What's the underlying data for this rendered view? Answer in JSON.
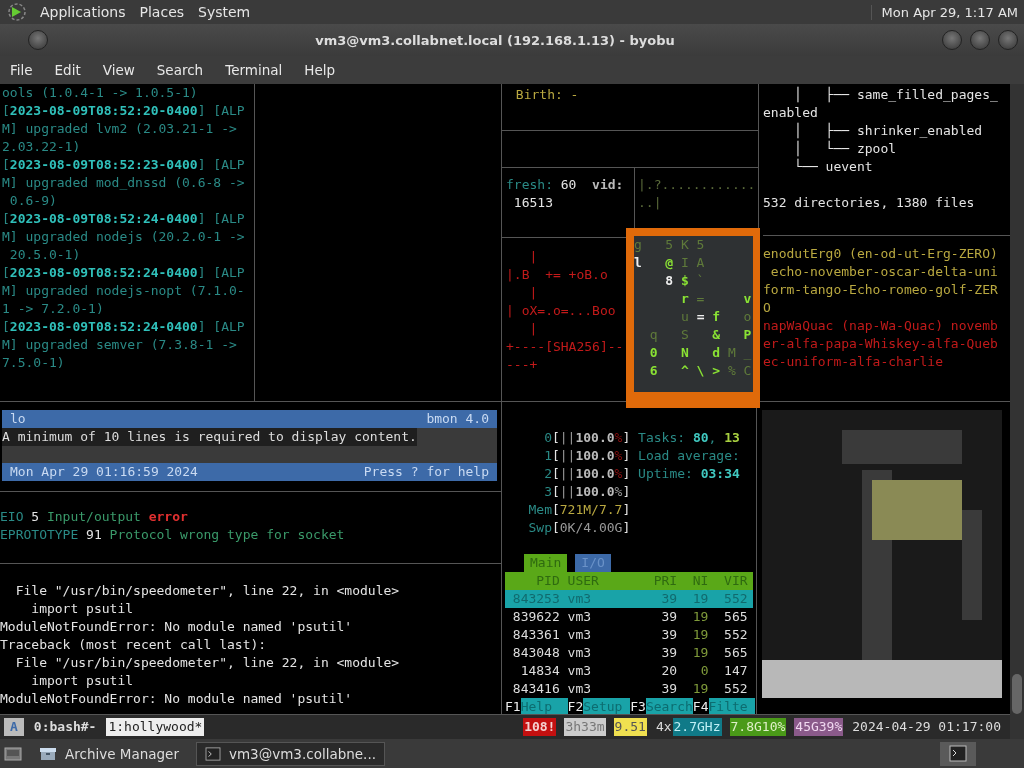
{
  "top_panel": {
    "menus": [
      "Applications",
      "Places",
      "System"
    ],
    "clock": "Mon Apr 29, 1:17 AM"
  },
  "window": {
    "title": "vm3@vm3.collabnet.local (192.168.1.13) - byobu",
    "menu": [
      "File",
      "Edit",
      "View",
      "Search",
      "Terminal",
      "Help"
    ]
  },
  "log": [
    [
      {
        "text": "ools (1.0.4-1 -> 1.0.5-1)",
        "kind": "dim"
      }
    ],
    [
      {
        "text": "[",
        "kind": "dim"
      },
      {
        "text": "2023-08-09T08:52:20-0400",
        "kind": "ts"
      },
      {
        "text": "] [ALP",
        "kind": "dim"
      }
    ],
    [
      {
        "text": "M] upgraded lvm2 (2.03.21-1 ->",
        "kind": "dim"
      }
    ],
    [
      {
        "text": "2.03.22-1)",
        "kind": "dim"
      }
    ],
    [
      {
        "text": "[",
        "kind": "dim"
      },
      {
        "text": "2023-08-09T08:52:23-0400",
        "kind": "ts"
      },
      {
        "text": "] [ALP",
        "kind": "dim"
      }
    ],
    [
      {
        "text": "M] upgraded mod_dnssd (0.6-8 ->",
        "kind": "dim"
      }
    ],
    [
      {
        "text": " 0.6-9)",
        "kind": "dim"
      }
    ],
    [
      {
        "text": "[",
        "kind": "dim"
      },
      {
        "text": "2023-08-09T08:52:24-0400",
        "kind": "ts"
      },
      {
        "text": "] [ALP",
        "kind": "dim"
      }
    ],
    [
      {
        "text": "M] upgraded nodejs (20.2.0-1 ->",
        "kind": "dim"
      }
    ],
    [
      {
        "text": " 20.5.0-1)",
        "kind": "dim"
      }
    ],
    [
      {
        "text": "[",
        "kind": "dim"
      },
      {
        "text": "2023-08-09T08:52:24-0400",
        "kind": "ts"
      },
      {
        "text": "] [ALP",
        "kind": "dim"
      }
    ],
    [
      {
        "text": "M] upgraded nodejs-nopt (7.1.0-",
        "kind": "dim"
      }
    ],
    [
      {
        "text": "1 -> 7.2.0-1)",
        "kind": "dim"
      }
    ],
    [
      {
        "text": "[",
        "kind": "dim"
      },
      {
        "text": "2023-08-09T08:52:24-0400",
        "kind": "ts"
      },
      {
        "text": "] [ALP",
        "kind": "dim"
      }
    ],
    [
      {
        "text": "M] upgraded semver (7.3.8-1 ->",
        "kind": "dim"
      }
    ],
    [
      {
        "text": "7.5.0-1)",
        "kind": "dim"
      }
    ]
  ],
  "stat": {
    "birth": [
      {
        "text": " Birth: -",
        "kind": "olive"
      }
    ],
    "fresh": [
      [
        {
          "text": "fresh:",
          "kind": "dim"
        },
        {
          "text": " 60  ",
          "kind": "white"
        },
        {
          "text": "vid:",
          "kind": "bold"
        }
      ],
      [
        {
          "text": " 16513",
          "kind": "white"
        }
      ]
    ],
    "vid": [
      [
        {
          "text": "|.?............",
          "kind": "dimgreen"
        }
      ],
      [
        {
          "text": "..|",
          "kind": "dimgreen"
        }
      ]
    ],
    "art": [
      [
        {
          "text": "   |",
          "kind": "red"
        }
      ],
      [
        {
          "text": "|.B  += +oB.o",
          "kind": "red"
        }
      ],
      [
        {
          "text": "   |",
          "kind": "red"
        }
      ],
      [
        {
          "text": "| oX=.o=...Boo",
          "kind": "red"
        }
      ],
      [
        {
          "text": "   |",
          "kind": "red"
        }
      ],
      [
        {
          "text": "+----[SHA256]--",
          "kind": "red"
        }
      ],
      [
        {
          "text": "---+",
          "kind": "red"
        }
      ]
    ]
  },
  "tree": {
    "lines": [
      [
        {
          "text": "    │   ├── same_filled_pages_",
          "kind": "white"
        }
      ],
      [
        {
          "text": "enabled",
          "kind": "white"
        }
      ],
      [
        {
          "text": "    │   ├── shrinker_enabled",
          "kind": "white"
        }
      ],
      [
        {
          "text": "    │   └── zpool",
          "kind": "white"
        }
      ],
      [
        {
          "text": "    └── uevent",
          "kind": "white"
        }
      ]
    ],
    "summary": "532 directories, 1380 files",
    "words": [
      [
        {
          "text": "enodutErg0 (en-od-ut-Erg-ZERO)",
          "kind": "olive"
        }
      ],
      [
        {
          "text": " echo-november-oscar-delta-uni",
          "kind": "olive"
        }
      ],
      [
        {
          "text": "form-tango-Echo-romeo-golf-ZER",
          "kind": "olive"
        }
      ],
      [
        {
          "text": "O",
          "kind": "olive"
        }
      ],
      [
        {
          "text": "napWaQuac (nap-Wa-Quac) novemb",
          "kind": "red"
        }
      ],
      [
        {
          "text": "er-alfa-papa-Whiskey-alfa-Queb",
          "kind": "red"
        }
      ],
      [
        {
          "text": "ec-uniform-alfa-charlie",
          "kind": "red"
        }
      ]
    ]
  },
  "matrix": [
    [
      {
        "text": "g   5 K 5",
        "kind": "md"
      }
    ],
    [
      {
        "text": "l   ",
        "kind": "mw"
      },
      {
        "text": "@",
        "kind": "mb"
      },
      {
        "text": " I A",
        "kind": "md"
      }
    ],
    [
      {
        "text": "    8 ",
        "kind": "mw"
      },
      {
        "text": "$",
        "kind": "mb"
      },
      {
        "text": " `",
        "kind": "md"
      }
    ],
    [
      {
        "text": "      r",
        "kind": "mb"
      },
      {
        "text": " =     ",
        "kind": "md"
      },
      {
        "text": "v",
        "kind": "mb"
      }
    ],
    [
      {
        "text": "      u ",
        "kind": "md"
      },
      {
        "text": "= ",
        "kind": "mw"
      },
      {
        "text": "f",
        "kind": "mb"
      },
      {
        "text": "   o",
        "kind": "md"
      }
    ],
    [
      {
        "text": "  q   S   ",
        "kind": "md"
      },
      {
        "text": "&   P",
        "kind": "mb"
      }
    ],
    [
      {
        "text": "  0   N   d",
        "kind": "mb"
      },
      {
        "text": " M _",
        "kind": "md"
      }
    ],
    [
      {
        "text": "  6   ^ \\ >",
        "kind": "mb"
      },
      {
        "text": " % C",
        "kind": "md"
      }
    ]
  ],
  "bmon": {
    "interface": "lo",
    "version": "bmon 4.0",
    "message": "A minimum of 10 lines is required to display content.",
    "date": "Mon Apr 29 01:16:59 2024",
    "hint": "Press ? for help"
  },
  "errno": [
    [
      {
        "text": "EIO",
        "kind": "dim"
      },
      {
        "text": " 5 ",
        "kind": "white"
      },
      {
        "text": "Input/output ",
        "kind": "green"
      },
      {
        "text": "error",
        "kind": "boldred"
      }
    ],
    [
      {
        "text": "EPROTOTYPE",
        "kind": "dim"
      },
      {
        "text": " 91 ",
        "kind": "white"
      },
      {
        "text": "Protocol wrong type for socket",
        "kind": "green"
      }
    ]
  ],
  "traceback": [
    "  File \"/usr/bin/speedometer\", line 22, in <module>",
    "    import psutil",
    "ModuleNotFoundError: No module named 'psutil'",
    "Traceback (most recent call last):",
    "  File \"/usr/bin/speedometer\", line 22, in <module>",
    "    import psutil",
    "ModuleNotFoundError: No module named 'psutil'"
  ],
  "htop": {
    "meters": [
      [
        {
          "text": "     0",
          "kind": "dimcyan"
        },
        {
          "text": "[",
          "kind": "white"
        },
        {
          "text": "||",
          "kind": "grey"
        },
        {
          "text": "100.0",
          "kind": "bold"
        },
        {
          "text": "%",
          "kind": "darkred"
        },
        {
          "text": "] ",
          "kind": "white"
        },
        {
          "text": "Tasks: ",
          "kind": "dimcyan"
        },
        {
          "text": "80",
          "kind": "boldcyan"
        },
        {
          "text": ", ",
          "kind": "dimcyan"
        },
        {
          "text": "13",
          "kind": "boldgreen"
        }
      ],
      [
        {
          "text": "     1",
          "kind": "dimcyan"
        },
        {
          "text": "[",
          "kind": "white"
        },
        {
          "text": "||",
          "kind": "grey"
        },
        {
          "text": "100.0",
          "kind": "bold"
        },
        {
          "text": "%",
          "kind": "darkred"
        },
        {
          "text": "] ",
          "kind": "white"
        },
        {
          "text": "Load average:",
          "kind": "dimcyan"
        }
      ],
      [
        {
          "text": "     2",
          "kind": "dimcyan"
        },
        {
          "text": "[",
          "kind": "white"
        },
        {
          "text": "||",
          "kind": "grey"
        },
        {
          "text": "100.0",
          "kind": "bold"
        },
        {
          "text": "%",
          "kind": "darkred"
        },
        {
          "text": "] ",
          "kind": "white"
        },
        {
          "text": "Uptime: ",
          "kind": "dimcyan"
        },
        {
          "text": "03:34",
          "kind": "boldcyan"
        }
      ],
      [
        {
          "text": "     3",
          "kind": "dimcyan"
        },
        {
          "text": "[",
          "kind": "white"
        },
        {
          "text": "||",
          "kind": "grey"
        },
        {
          "text": "100.0",
          "kind": "bold"
        },
        {
          "text": "%",
          "kind": "grey"
        },
        {
          "text": "]",
          "kind": "white"
        }
      ],
      [
        {
          "text": "   Mem",
          "kind": "dimcyan"
        },
        {
          "text": "[",
          "kind": "white"
        },
        {
          "text": "721M/7.7",
          "kind": "olive"
        },
        {
          "text": "]",
          "kind": "white"
        }
      ],
      [
        {
          "text": "   Swp",
          "kind": "dimcyan"
        },
        {
          "text": "[",
          "kind": "white"
        },
        {
          "text": "0K/4.00G",
          "kind": "grey"
        },
        {
          "text": "]",
          "kind": "white"
        }
      ]
    ],
    "tabs": [
      {
        "label": "Main",
        "selected": true
      },
      {
        "label": "I/O",
        "selected": false
      }
    ],
    "columns": [
      "PID",
      "USER",
      "PRI",
      "NI",
      "VIR"
    ],
    "rows": [
      {
        "cells": [
          "843253",
          "vm3",
          "39",
          "19",
          "552"
        ],
        "selected": true
      },
      {
        "cells": [
          "839622",
          "vm3",
          "39",
          "19",
          "565"
        ],
        "selected": false
      },
      {
        "cells": [
          "843361",
          "vm3",
          "39",
          "19",
          "552"
        ],
        "selected": false
      },
      {
        "cells": [
          "843048",
          "vm3",
          "39",
          "19",
          "565"
        ],
        "selected": false
      },
      {
        "cells": [
          "14834",
          "vm3",
          "20",
          "0",
          "147"
        ],
        "selected": false
      },
      {
        "cells": [
          "843416",
          "vm3",
          "39",
          "19",
          "552"
        ],
        "selected": false
      }
    ],
    "fkeys": [
      {
        "key": "F1",
        "label": "Help"
      },
      {
        "key": "F2",
        "label": "Setup"
      },
      {
        "key": "F3",
        "label": "Search"
      },
      {
        "key": "F4",
        "label": "Filte"
      }
    ]
  },
  "byobu": {
    "badge": "A",
    "windows": [
      {
        "label": "0:bash#-",
        "selected": false
      },
      {
        "label": "1:hollywood*",
        "selected": true
      }
    ],
    "status": [
      {
        "text": "108!",
        "kind": "red"
      },
      {
        "text": "3h33m",
        "kind": "grey"
      },
      {
        "text": "9.51",
        "kind": "yellow"
      },
      {
        "text": "4x",
        "kind": "plain"
      },
      {
        "text": "2.7GHz",
        "kind": "cyan"
      },
      {
        "text": "7.8G10%",
        "kind": "green"
      },
      {
        "text": "45G39%",
        "kind": "purple"
      },
      {
        "text": "2024-04-29 01:17:00",
        "kind": "plain"
      }
    ]
  },
  "taskbar": [
    {
      "label": "Archive Manager",
      "kind": "archive",
      "selected": false
    },
    {
      "label": "vm3@vm3.collabne...",
      "kind": "terminal",
      "selected": true
    }
  ]
}
